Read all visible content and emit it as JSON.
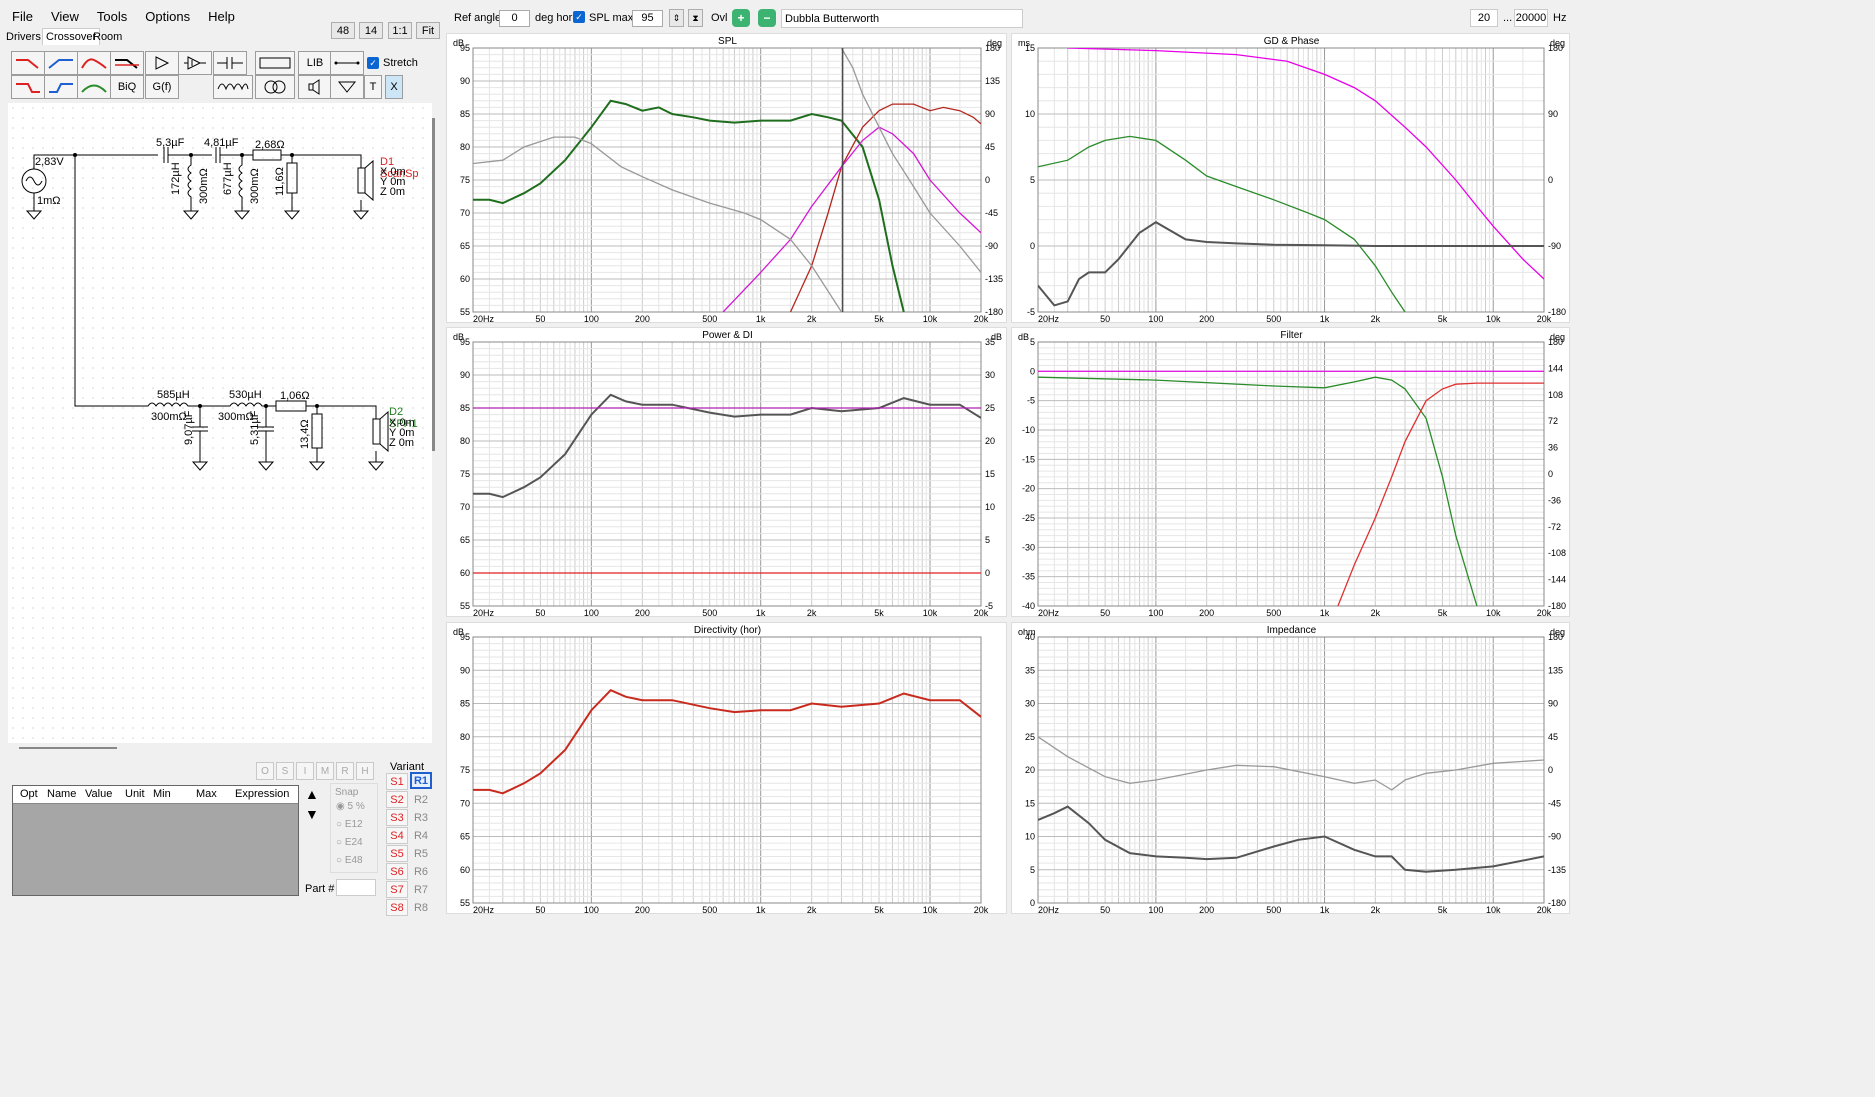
{
  "menu": [
    "File",
    "View",
    "Tools",
    "Options",
    "Help"
  ],
  "tabs": [
    "Drivers",
    "Crossover",
    "Room"
  ],
  "topbtns": [
    "48",
    "14",
    "1:1",
    "Fit"
  ],
  "toolbar": {
    "ref_label": "Ref angle",
    "ref_value": "0",
    "deg_hor": "deg hor",
    "spl_max_label": "SPL max",
    "spl_max_value": "95",
    "ovl": "Ovl",
    "filter_name": "Dubbla Butterworth",
    "f_low": "20",
    "dots": "...",
    "f_high": "20000",
    "hz": "Hz"
  },
  "tools": {
    "lib": "LIB",
    "biq": "BiQ",
    "gf": "G(f)",
    "t": "T",
    "x": "X",
    "stretch": "Stretch"
  },
  "schematic": {
    "source": "2,83V",
    "source_r": "1mΩ",
    "c1": "5,3µF",
    "c2": "4,81µF",
    "r1": "2,68Ω",
    "l1": "172µH",
    "l1r": "300mΩ",
    "l2": "677µH",
    "l2r": "300mΩ",
    "r2": "11,6Ω",
    "d1": "D1 ScanSp",
    "d1x": "X 0m",
    "d1y": "Y 0m",
    "d1z": "Z 0m",
    "l3": "585µH",
    "l3r": "300mΩ",
    "l4": "530µH",
    "l4r": "300mΩ",
    "r3": "1,06Ω",
    "c3": "9,07µF",
    "c4": "5,31µF",
    "r4": "13,4Ω",
    "d2": "D2 SPH1",
    "d2x": "X 0m",
    "d2y": "Y 0m",
    "d2z": "Z 0m"
  },
  "opt": {
    "flags": [
      "O",
      "S",
      "I",
      "M",
      "R",
      "H"
    ],
    "columns": [
      "Opt",
      "Name",
      "Value",
      "Unit",
      "Min",
      "Max",
      "Expression"
    ],
    "snap": "Snap",
    "snap_opts": [
      "5 %",
      "E12",
      "E24",
      "E48"
    ],
    "part": "Part #",
    "variant": "Variant",
    "s": [
      "S1",
      "S2",
      "S3",
      "S4",
      "S5",
      "S6",
      "S7",
      "S8"
    ],
    "r": [
      "R1",
      "R2",
      "R3",
      "R4",
      "R5",
      "R6",
      "R7",
      "R8"
    ]
  },
  "charts": {
    "spl": {
      "title": "SPL",
      "lu": "dB",
      "ru": "deg",
      "left": [
        "95",
        "90",
        "85",
        "80",
        "75",
        "70",
        "65",
        "60",
        "55"
      ],
      "right": [
        "180",
        "135",
        "90",
        "45",
        "0",
        "-45",
        "-90",
        "-135",
        "-180"
      ]
    },
    "gd": {
      "title": "GD & Phase",
      "lu": "ms",
      "ru": "deg",
      "left": [
        "15",
        "10",
        "5",
        "0",
        "-5"
      ],
      "right": [
        "180",
        "90",
        "0",
        "-90",
        "-180"
      ]
    },
    "power": {
      "title": "Power & DI",
      "lu": "dB",
      "ru": "dB",
      "left": [
        "95",
        "90",
        "85",
        "80",
        "75",
        "70",
        "65",
        "60",
        "55"
      ],
      "right": [
        "35",
        "30",
        "25",
        "20",
        "15",
        "10",
        "5",
        "0",
        "-5"
      ]
    },
    "filter": {
      "title": "Filter",
      "lu": "dB",
      "ru": "deg",
      "left": [
        "5",
        "0",
        "-5",
        "-10",
        "-15",
        "-20",
        "-25",
        "-30",
        "-35",
        "-40"
      ],
      "right": [
        "180",
        "144",
        "108",
        "72",
        "36",
        "0",
        "-36",
        "-72",
        "-108",
        "-144",
        "-180"
      ]
    },
    "dir": {
      "title": "Directivity (hor)",
      "lu": "dB",
      "left": [
        "95",
        "90",
        "85",
        "80",
        "75",
        "70",
        "65",
        "60",
        "55"
      ]
    },
    "imp": {
      "title": "Impedance",
      "lu": "ohm",
      "ru": "deg",
      "left": [
        "40",
        "35",
        "30",
        "25",
        "20",
        "15",
        "10",
        "5",
        "0"
      ],
      "right": [
        "180",
        "135",
        "90",
        "45",
        "0",
        "-45",
        "-90",
        "-135",
        "-180"
      ]
    },
    "freq": [
      "20Hz",
      "50",
      "100",
      "200",
      "500",
      "1k",
      "2k",
      "5k",
      "10k",
      "20k"
    ]
  },
  "chart_data": [
    {
      "type": "line",
      "title": "SPL",
      "ylim": [
        55,
        95
      ],
      "y2lim": [
        -180,
        180
      ],
      "series": [
        {
          "color": "#1e6e1e",
          "x": [
            20,
            25,
            30,
            40,
            50,
            70,
            100,
            130,
            160,
            200,
            250,
            300,
            400,
            500,
            700,
            1000,
            1500,
            2000,
            2500,
            3000,
            4000,
            5000,
            6000,
            7000
          ],
          "y": [
            72,
            72,
            71.5,
            73,
            74.5,
            78,
            83,
            87,
            86.5,
            85.5,
            86,
            85,
            84.5,
            84,
            83.7,
            84,
            84,
            85,
            84.5,
            84,
            80,
            72,
            62,
            55
          ]
        },
        {
          "color": "#b4261e",
          "x": [
            1500,
            2000,
            2500,
            3000,
            4000,
            5000,
            6000,
            8000,
            10000,
            12000,
            15000,
            18000,
            20000
          ],
          "y": [
            55,
            62,
            70,
            77,
            83,
            85.5,
            86.5,
            86.5,
            85.5,
            86,
            85.5,
            84.5,
            83.5
          ]
        },
        {
          "color": "#d419d4",
          "x": [
            600,
            1000,
            1500,
            2000,
            3000,
            4000,
            5000,
            6000,
            8000,
            10000,
            15000,
            20000
          ],
          "y": [
            55,
            61,
            66,
            71,
            77,
            81,
            83,
            82,
            79,
            75,
            70,
            67
          ]
        },
        {
          "color": "#999999",
          "x": [
            20,
            30,
            40,
            60,
            80,
            100,
            150,
            200,
            300,
            500,
            800,
            1000,
            1500,
            2000,
            3000
          ],
          "y": [
            77.5,
            78,
            80,
            81.5,
            81.5,
            80.5,
            77,
            75.5,
            73.5,
            71.5,
            70,
            69,
            66,
            62,
            55
          ]
        },
        {
          "color": "#999999",
          "x": [
            3000,
            3500,
            4000,
            5000,
            6000,
            8000,
            10000,
            15000,
            20000
          ],
          "y": [
            95,
            92,
            88,
            83,
            79,
            74,
            70,
            65,
            61
          ]
        },
        {
          "color": "#444444",
          "x": [
            3050,
            3050
          ],
          "y": [
            55,
            95
          ]
        }
      ]
    },
    {
      "type": "line",
      "title": "GD & Phase",
      "ylim": [
        -5,
        15
      ],
      "series": [
        {
          "color": "#e800e8",
          "x": [
            30,
            100,
            300,
            600,
            1000,
            1500,
            2000,
            3000,
            4000,
            6000,
            8000,
            10000,
            15000,
            20000
          ],
          "y": [
            15,
            14.8,
            14.5,
            14,
            13,
            12,
            11,
            9,
            7.5,
            5,
            3,
            1.5,
            -1,
            -2.5
          ]
        },
        {
          "color": "#2a8c2a",
          "x": [
            20,
            30,
            40,
            50,
            70,
            100,
            150,
            200,
            300,
            500,
            800,
            1000,
            1500,
            2000,
            2500,
            3000
          ],
          "y": [
            6,
            6.5,
            7.5,
            8,
            8.3,
            8,
            6.5,
            5.3,
            4.5,
            3.5,
            2.5,
            2,
            0.5,
            -1.5,
            -3.5,
            -5
          ]
        },
        {
          "color": "#555555",
          "x": [
            20,
            25,
            30,
            35,
            40,
            50,
            60,
            80,
            100,
            150,
            200,
            300,
            500,
            1000,
            2000,
            5000,
            10000,
            20000
          ],
          "y": [
            -3,
            -4.5,
            -4.2,
            -2.5,
            -2,
            -2,
            -1,
            1,
            1.8,
            0.5,
            0.3,
            0.2,
            0.1,
            0.05,
            0,
            0,
            0,
            0
          ]
        }
      ]
    },
    {
      "type": "line",
      "title": "Power & DI",
      "ylim": [
        55,
        95
      ],
      "series": [
        {
          "color": "#555555",
          "x": [
            20,
            25,
            30,
            40,
            50,
            70,
            100,
            130,
            160,
            200,
            300,
            500,
            700,
            1000,
            1500,
            2000,
            3000,
            5000,
            7000,
            10000,
            15000,
            20000
          ],
          "y": [
            72,
            72,
            71.5,
            73,
            74.5,
            78,
            84,
            87,
            86,
            85.5,
            85.5,
            84.3,
            83.7,
            84,
            84,
            85,
            84.5,
            85,
            86.5,
            85.5,
            85.5,
            83.5
          ]
        },
        {
          "color": "#b020b0",
          "x": [
            20,
            20000
          ],
          "y": [
            85,
            85
          ]
        },
        {
          "color": "#e02020",
          "x": [
            20,
            20000
          ],
          "y": [
            60,
            60
          ]
        }
      ]
    },
    {
      "type": "line",
      "title": "Filter",
      "ylim": [
        -40,
        5
      ],
      "series": [
        {
          "color": "#e020e0",
          "x": [
            20,
            20000
          ],
          "y": [
            0,
            0
          ]
        },
        {
          "color": "#2a8c2a",
          "x": [
            20,
            100,
            500,
            1000,
            1500,
            2000,
            2500,
            3000,
            4000,
            5000,
            6000,
            8000,
            10000
          ],
          "y": [
            -1,
            -1.5,
            -2.5,
            -2.8,
            -1.8,
            -1,
            -1.5,
            -3,
            -8,
            -18,
            -28,
            -40,
            -45
          ]
        },
        {
          "color": "#e03030",
          "x": [
            1200,
            1500,
            2000,
            2500,
            3000,
            4000,
            5000,
            6000,
            8000,
            10000,
            20000
          ],
          "y": [
            -40,
            -33,
            -25,
            -18,
            -12,
            -5,
            -3,
            -2.2,
            -2,
            -2,
            -2
          ]
        }
      ]
    },
    {
      "type": "line",
      "title": "Directivity (hor)",
      "ylim": [
        55,
        95
      ],
      "series": [
        {
          "color": "#c82a1e",
          "x": [
            20,
            25,
            30,
            40,
            50,
            70,
            100,
            130,
            160,
            200,
            300,
            500,
            700,
            1000,
            1500,
            2000,
            3000,
            5000,
            7000,
            10000,
            15000,
            20000
          ],
          "y": [
            72,
            72,
            71.5,
            73,
            74.5,
            78,
            84,
            87,
            86,
            85.5,
            85.5,
            84.3,
            83.7,
            84,
            84,
            85,
            84.5,
            85,
            86.5,
            85.5,
            85.5,
            83
          ]
        }
      ]
    },
    {
      "type": "line",
      "title": "Impedance",
      "ylim": [
        0,
        40
      ],
      "series": [
        {
          "color": "#999999",
          "x": [
            20,
            30,
            50,
            70,
            100,
            200,
            300,
            500,
            1000,
            1500,
            2000,
            2500,
            3000,
            4000,
            6000,
            10000,
            20000
          ],
          "y": [
            25,
            22,
            19,
            18,
            18.5,
            20,
            20.7,
            20.5,
            19,
            18,
            18.5,
            17,
            18.5,
            19.5,
            20,
            21,
            21.5
          ]
        },
        {
          "color": "#555555",
          "x": [
            20,
            25,
            30,
            40,
            50,
            70,
            100,
            150,
            200,
            300,
            500,
            700,
            1000,
            1500,
            2000,
            2500,
            3000,
            4000,
            6000,
            10000,
            20000
          ],
          "y": [
            12.5,
            13.5,
            14.5,
            12,
            9.5,
            7.5,
            7,
            6.8,
            6.6,
            6.8,
            8.5,
            9.5,
            10,
            8,
            7,
            7,
            5,
            4.7,
            5,
            5.5,
            7
          ]
        }
      ]
    }
  ]
}
